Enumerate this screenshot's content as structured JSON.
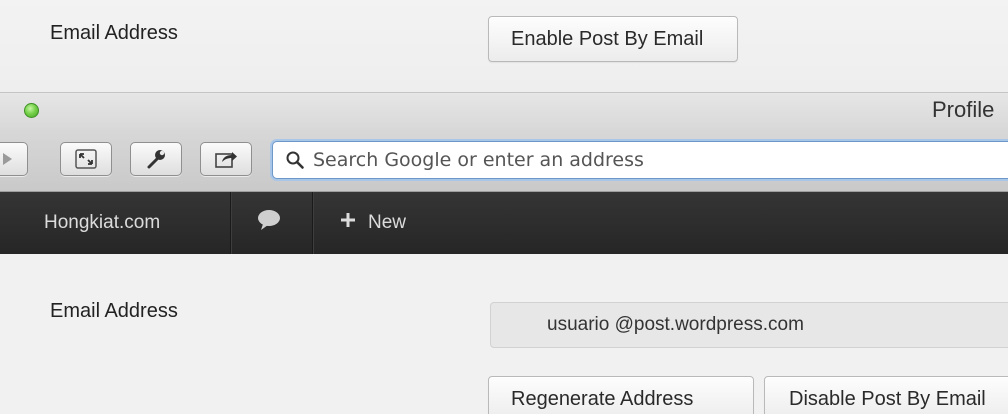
{
  "top_settings": {
    "email_label": "Email Address",
    "enable_button_label": "Enable Post By Email"
  },
  "browser": {
    "window_title": "Profile",
    "search": {
      "placeholder": "Search Google or enter an address",
      "value": ""
    },
    "toolbar_icons": [
      "forward-icon",
      "fullscreen-icon",
      "wrench-icon",
      "share-icon"
    ]
  },
  "admin_bar": {
    "site_name": "Hongkiat.com",
    "new_label": "New",
    "comments_icon": "speech-bubble-icon",
    "plus_icon": "plus-icon"
  },
  "bottom_settings": {
    "email_label": "Email Address",
    "email_value": "usuario @post.wordpress.com",
    "regenerate_button_label": "Regenerate Address",
    "disable_button_label": "Disable Post By Email"
  },
  "colors": {
    "admin_bar_bg": "#2b2b2b",
    "traffic_light_green": "#5fc133",
    "address_focus_ring": "#a8c6e8"
  }
}
